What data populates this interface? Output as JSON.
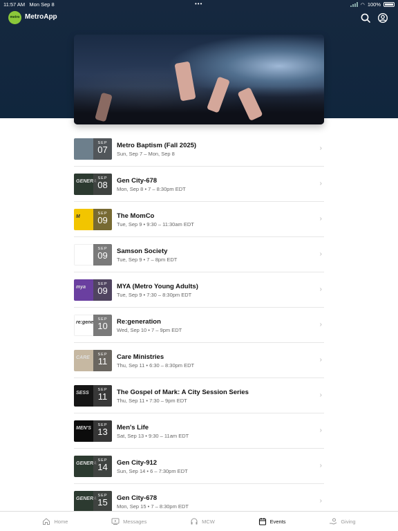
{
  "status_bar": {
    "time": "11:57 AM",
    "date": "Mon Sep 8",
    "battery": "100%"
  },
  "app": {
    "name": "MetroApp",
    "logo_text": "metro"
  },
  "icons": {
    "search": "search-icon",
    "account": "account-icon"
  },
  "events": [
    {
      "month": "SEP",
      "day": "07",
      "title": "Metro Baptism (Fall 2025)",
      "subtitle": "Sun, Sep 7 – Mon, Sep 8",
      "thumb_color": "#6d7f8c",
      "thumb_tag": ""
    },
    {
      "month": "SEP",
      "day": "08",
      "title": "Gen City-678",
      "subtitle": "Mon, Sep 8 • 7 – 8:30pm EDT",
      "thumb_color": "#2c3a30",
      "thumb_tag": "GENERA"
    },
    {
      "month": "SEP",
      "day": "09",
      "title": "The MomCo",
      "subtitle": "Tue, Sep 9 • 9:30 – 11:30am EDT",
      "thumb_color": "#f2c500",
      "thumb_tag": "M"
    },
    {
      "month": "SEP",
      "day": "09",
      "title": "Samson Society",
      "subtitle": "Tue, Sep 9 • 7 – 8pm EDT",
      "thumb_color": "#ffffff",
      "thumb_tag": ""
    },
    {
      "month": "SEP",
      "day": "09",
      "title": "MYA (Metro Young Adults)",
      "subtitle": "Tue, Sep 9 • 7:30 – 8:30pm EDT",
      "thumb_color": "#6a3fa0",
      "thumb_tag": "mya"
    },
    {
      "month": "SEP",
      "day": "10",
      "title": "Re:generation",
      "subtitle": "Wed, Sep 10 • 7 – 9pm EDT",
      "thumb_color": "#ffffff",
      "thumb_tag": "re:gene"
    },
    {
      "month": "SEP",
      "day": "11",
      "title": "Care Ministries",
      "subtitle": "Thu, Sep 11 • 6:30 – 8:30pm EDT",
      "thumb_color": "#c6b8a2",
      "thumb_tag": "CARE"
    },
    {
      "month": "SEP",
      "day": "11",
      "title": "The Gospel of Mark: A City Session Series",
      "subtitle": "Thu, Sep 11 • 7:30 – 9pm EDT",
      "thumb_color": "#151515",
      "thumb_tag": "SESS"
    },
    {
      "month": "SEP",
      "day": "13",
      "title": "Men's Life",
      "subtitle": "Sat, Sep 13 • 9:30 – 11am EDT",
      "thumb_color": "#0c0c0c",
      "thumb_tag": "MEN'S"
    },
    {
      "month": "SEP",
      "day": "14",
      "title": "Gen City-912",
      "subtitle": "Sun, Sep 14 • 6 – 7:30pm EDT",
      "thumb_color": "#2c3a30",
      "thumb_tag": "GENERA"
    },
    {
      "month": "SEP",
      "day": "15",
      "title": "Gen City-678",
      "subtitle": "Mon, Sep 15 • 7 – 8:30pm EDT",
      "thumb_color": "#2c3a30",
      "thumb_tag": "GENERA"
    }
  ],
  "tabs": [
    {
      "label": "Home",
      "icon": "home-icon",
      "active": false
    },
    {
      "label": "Messages",
      "icon": "messages-icon",
      "active": false
    },
    {
      "label": "MCW",
      "icon": "headphones-icon",
      "active": false
    },
    {
      "label": "Events",
      "icon": "calendar-icon",
      "active": true
    },
    {
      "label": "Giving",
      "icon": "giving-icon",
      "active": false
    }
  ]
}
